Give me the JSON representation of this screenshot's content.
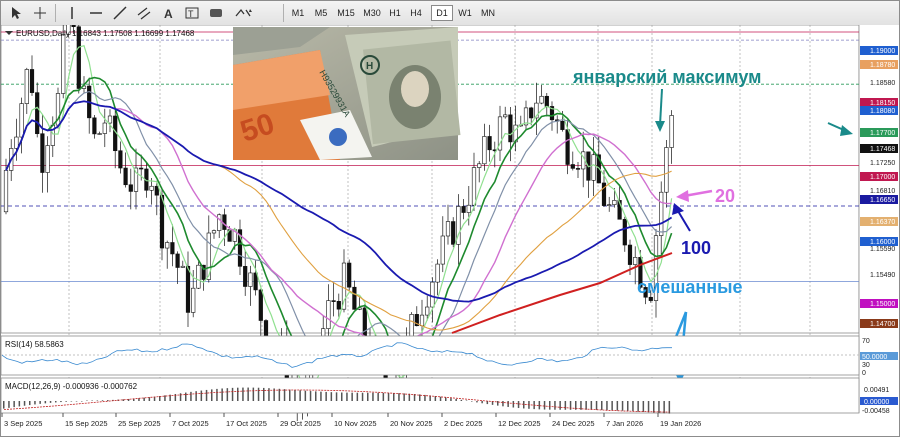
{
  "toolbar": {
    "tools": [
      "cursor-icon",
      "crosshair-icon",
      "vertical-line-icon",
      "horizontal-line-icon",
      "trendline-icon",
      "channel-icon",
      "text-icon",
      "label-icon",
      "shapes-icon"
    ],
    "timeframes": [
      "M1",
      "M5",
      "M15",
      "M30",
      "H1",
      "H4",
      "D1",
      "W1",
      "MN"
    ],
    "active_timeframe": "D1"
  },
  "chart": {
    "symbol_line": "EURUSD,Daily  1.16843 1.17508 1.16699 1.17468",
    "annotations": {
      "jan_high": "январский максимум",
      "ma20": "20",
      "ma100": "100",
      "mixed": "смешанные"
    },
    "price_labels": [
      {
        "text": "1.19000",
        "bg": "#1f5fd0",
        "fg": "#ffffff"
      },
      {
        "text": "1.18780",
        "bg": "#e8a060",
        "fg": "#ffffff"
      },
      {
        "text": "1.18580",
        "bg": "",
        "fg": "#222222"
      },
      {
        "text": "1.18150",
        "bg": "#c01850",
        "fg": "#ffffff"
      },
      {
        "text": "1.18080",
        "bg": "#1f5fd0",
        "fg": "#ffffff"
      },
      {
        "text": "1.17700",
        "bg": "#2a9a5a",
        "fg": "#ffffff"
      },
      {
        "text": "1.17468",
        "bg": "#111111",
        "fg": "#ffffff"
      },
      {
        "text": "1.17250",
        "bg": "",
        "fg": "#222222"
      },
      {
        "text": "1.17000",
        "bg": "#c01850",
        "fg": "#ffffff"
      },
      {
        "text": "1.16810",
        "bg": "",
        "fg": "#222222"
      },
      {
        "text": "1.16650",
        "bg": "#1a1aa0",
        "fg": "#ffffff"
      },
      {
        "text": "1.16370",
        "bg": "#e3b070",
        "fg": "#ffffff"
      },
      {
        "text": "1.16000",
        "bg": "#1f5fd0",
        "fg": "#ffffff"
      },
      {
        "text": "1.15590",
        "bg": "",
        "fg": "#222222"
      },
      {
        "text": "1.15490",
        "bg": "",
        "fg": "#222222"
      },
      {
        "text": "1.15000",
        "bg": "#c010c0",
        "fg": "#ffffff"
      },
      {
        "text": "1.14700",
        "bg": "#8a3a1a",
        "fg": "#ffffff"
      }
    ],
    "rsi": {
      "title": "RSI(14) 58.5863",
      "levels": [
        "70",
        "50.0000",
        "30",
        "0"
      ]
    },
    "macd": {
      "title": "MACD(12,26,9) -0.000936 -0.000762",
      "levels": [
        "0.00491",
        "0.00000",
        "-0.00458"
      ]
    },
    "dates": [
      "3 Sep 2025",
      "15 Sep 2025",
      "25 Sep 2025",
      "7 Oct 2025",
      "17 Oct 2025",
      "29 Oct 2025",
      "10 Nov 2025",
      "20 Nov 2025",
      "2 Dec 2025",
      "12 Dec 2025",
      "24 Dec 2025",
      "7 Jan 2026",
      "19 Jan 2026"
    ]
  },
  "colors": {
    "teal_annotation": "#1a8a8a",
    "pink_annotation": "#e070e0",
    "navy_annotation": "#1a1ab0",
    "blue_annotation": "#2a9ae0"
  }
}
